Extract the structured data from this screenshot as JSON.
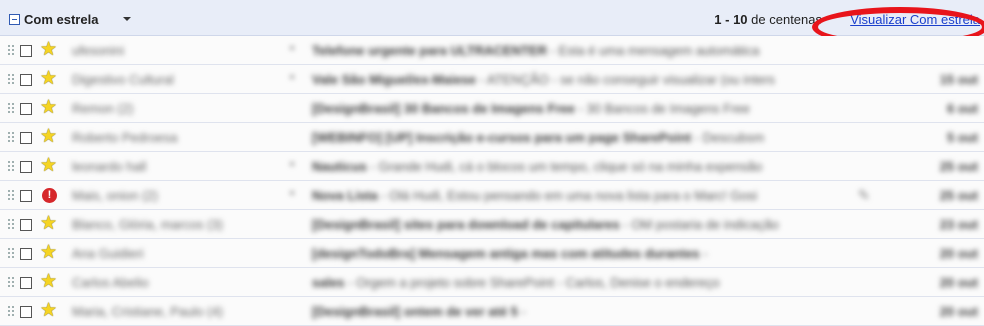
{
  "header": {
    "section_title": "Com estrela",
    "pager_range": "1 - 10",
    "pager_suffix": " de centenas",
    "view_link": "Visualizar Com estrela"
  },
  "colors": {
    "highlight_circle": "#e8141b",
    "link": "#1a3fcc",
    "star": "#f5d423",
    "important": "#d6282b"
  },
  "rows": [
    {
      "flag": "star",
      "sender": "ufesonini",
      "bullet": "•",
      "subject": "Telefone urgente para ULTRACENTER",
      "snippet": " - Esta é uma mensagem automática",
      "date": "",
      "clip": false
    },
    {
      "flag": "star",
      "sender": "Digestivo Cultural",
      "bullet": "•",
      "subject": "Vale São Miguel/ex-Maiese",
      "snippet": " - ATENÇÃO - se não conseguir visualizar (ou inters",
      "date": "15 out",
      "clip": false
    },
    {
      "flag": "star",
      "sender": "Remon (2)",
      "bullet": "",
      "subject": "[DesignBrasil] 30 Bancos de Imagens Free",
      "snippet": " - 30 Bancos de Imagens Free",
      "date": "6 out",
      "clip": false
    },
    {
      "flag": "star",
      "sender": "Roberto Pedroesa",
      "bullet": "",
      "subject": "[WEBINFO] [UP] Inscrição e-cursos para um page SharePoint",
      "snippet": " - Descubsm",
      "date": "5 out",
      "clip": false
    },
    {
      "flag": "star",
      "sender": "leonardo hall",
      "bullet": "•",
      "subject": "Nauticus",
      "snippet": " - Grande Hudi, cá o blocos um tempo, clique só na minha expensão",
      "date": "25 out",
      "clip": false
    },
    {
      "flag": "important",
      "sender": "Mais, onion (2)",
      "bullet": "•",
      "subject": "Nova Lista",
      "snippet": " - Olá Hudi, Estou pensando em uma nova lista para o Marc! Gosi",
      "date": "25 out",
      "clip": true
    },
    {
      "flag": "star",
      "sender": "Blanco, Glória, marcos (3)",
      "bullet": "",
      "subject": "[DesignBrasil] sites para download de capitulares",
      "snippet": " - OM postaria de indicação",
      "date": "23 out",
      "clip": false
    },
    {
      "flag": "star",
      "sender": "Ana Guidieri",
      "bullet": "",
      "subject": "[designTodoBra] Mensagem antiga mas com atitudes durantes",
      "snippet": " - ",
      "date": "20 out",
      "clip": false
    },
    {
      "flag": "star",
      "sender": "Carlos Abelio",
      "bullet": "",
      "subject": "sales",
      "snippet": " - Orgem a projeto sobre SharePoint - Carlos, Denise o endereço",
      "date": "20 out",
      "clip": false
    },
    {
      "flag": "star",
      "sender": "Maria, Cristiane, Paulo (4)",
      "bullet": "",
      "subject": "[DesignBrasil] ontem de ver até 5",
      "snippet": " - ",
      "date": "20 out",
      "clip": false
    }
  ]
}
